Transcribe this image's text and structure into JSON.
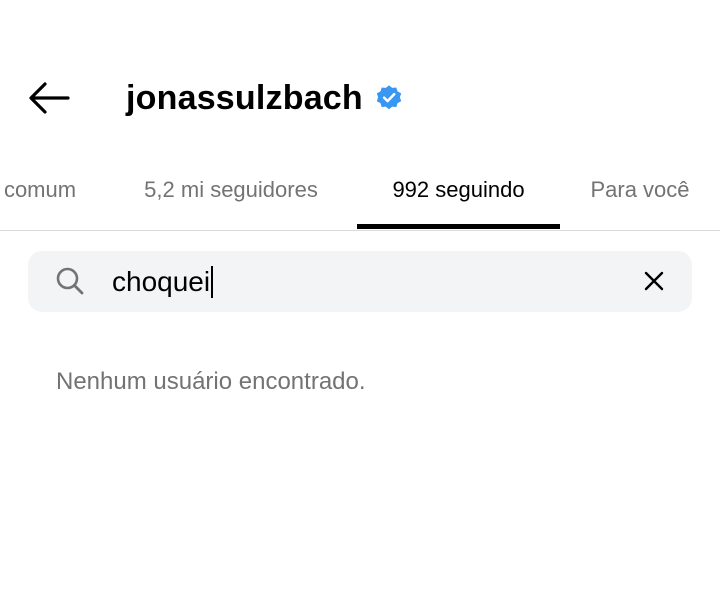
{
  "header": {
    "back_icon": "arrow-left-icon",
    "username": "jonassulzbach",
    "verified_icon": "verified-badge-icon",
    "verified_color": "#3897f0"
  },
  "tabs": [
    {
      "label": "comum",
      "active": false
    },
    {
      "label": "5,2 mi seguidores",
      "active": false
    },
    {
      "label": "992 seguindo",
      "active": true
    },
    {
      "label": "Para você",
      "active": false
    }
  ],
  "search": {
    "icon": "search-icon",
    "value": "choquei",
    "clear_icon": "close-icon"
  },
  "results": {
    "empty_message": "Nenhum usuário encontrado."
  }
}
